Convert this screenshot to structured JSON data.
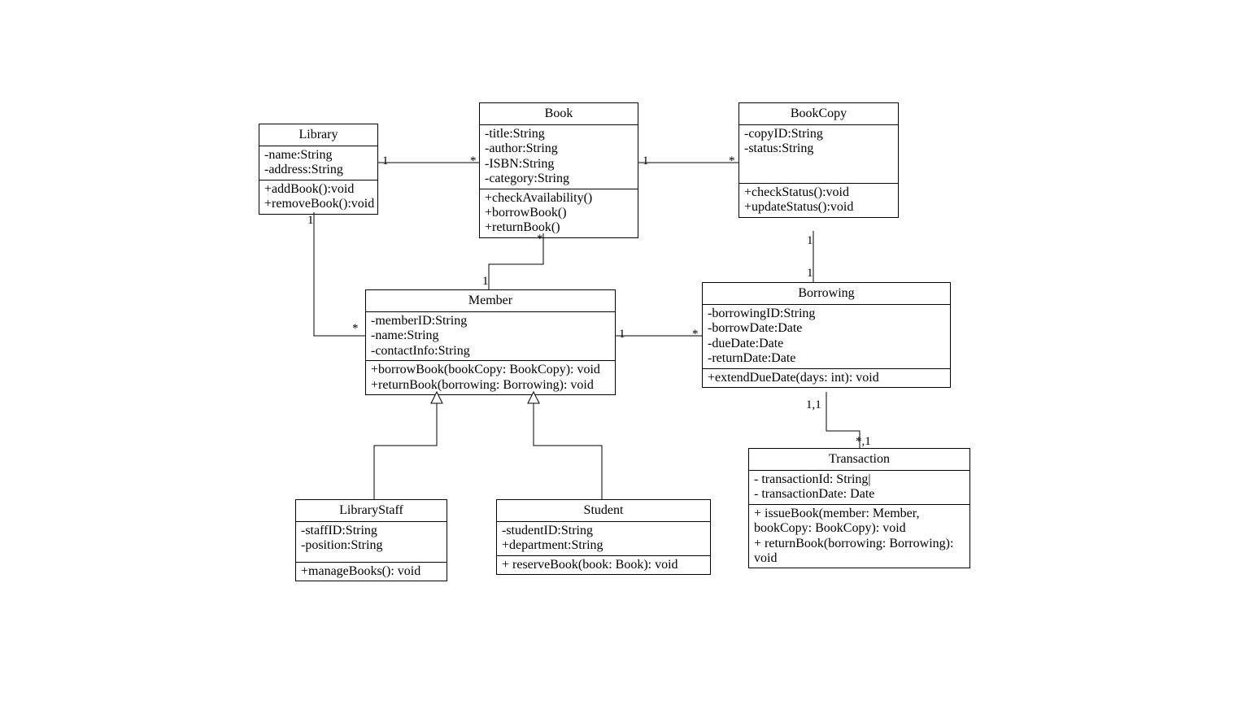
{
  "classes": {
    "library": {
      "name": "Library",
      "attrs": [
        "-name:String",
        "-address:String"
      ],
      "ops": [
        "+addBook():void",
        "+removeBook():void"
      ]
    },
    "book": {
      "name": "Book",
      "attrs": [
        "-title:String",
        "-author:String",
        "-ISBN:String",
        "-category:String"
      ],
      "ops": [
        "+checkAvailability()",
        "+borrowBook()",
        "+returnBook()"
      ]
    },
    "bookcopy": {
      "name": "BookCopy",
      "attrs": [
        "-copyID:String",
        "-status:String"
      ],
      "ops": [
        "+checkStatus():void",
        "+updateStatus():void"
      ]
    },
    "member": {
      "name": "Member",
      "attrs": [
        "-memberID:String",
        "-name:String",
        "-contactInfo:String"
      ],
      "ops": [
        "+borrowBook(bookCopy: BookCopy): void",
        "+returnBook(borrowing: Borrowing): void"
      ]
    },
    "borrowing": {
      "name": "Borrowing",
      "attrs": [
        "-borrowingID:String",
        "-borrowDate:Date",
        "-dueDate:Date",
        "-returnDate:Date"
      ],
      "ops": [
        "+extendDueDate(days: int): void"
      ]
    },
    "librarystaff": {
      "name": "LibraryStaff",
      "attrs": [
        "-staffID:String",
        "-position:String"
      ],
      "ops": [
        "+manageBooks(): void"
      ]
    },
    "student": {
      "name": "Student",
      "attrs": [
        "-studentID:String",
        "+department:String"
      ],
      "ops": [
        "+ reserveBook(book: Book): void"
      ]
    },
    "transaction": {
      "name": "Transaction",
      "attrs": [
        "- transactionId: String|",
        "- transactionDate: Date"
      ],
      "ops": [
        "+ issueBook(member: Member, bookCopy: BookCopy): void",
        "+ returnBook(borrowing: Borrowing): void"
      ]
    }
  },
  "mults": {
    "lib_book_l": "1",
    "lib_book_r": "*",
    "book_copy_l": "1",
    "book_copy_r": "*",
    "lib_member_t": "1",
    "lib_member_b": "*",
    "book_member_t": "*",
    "book_member_b": "1",
    "member_borrow_l": "1",
    "member_borrow_r": "*",
    "copy_borrow_t": "1",
    "copy_borrow_b": "1",
    "borrow_trans_t": "1,1",
    "borrow_trans_b": "*,1"
  },
  "chart_data": {
    "type": "table",
    "title": "UML Class Diagram — Library System",
    "classes": [
      {
        "name": "Library",
        "attributes": [
          "-name:String",
          "-address:String"
        ],
        "operations": [
          "+addBook():void",
          "+removeBook():void"
        ]
      },
      {
        "name": "Book",
        "attributes": [
          "-title:String",
          "-author:String",
          "-ISBN:String",
          "-category:String"
        ],
        "operations": [
          "+checkAvailability()",
          "+borrowBook()",
          "+returnBook()"
        ]
      },
      {
        "name": "BookCopy",
        "attributes": [
          "-copyID:String",
          "-status:String"
        ],
        "operations": [
          "+checkStatus():void",
          "+updateStatus():void"
        ]
      },
      {
        "name": "Member",
        "attributes": [
          "-memberID:String",
          "-name:String",
          "-contactInfo:String"
        ],
        "operations": [
          "+borrowBook(bookCopy: BookCopy): void",
          "+returnBook(borrowing: Borrowing): void"
        ]
      },
      {
        "name": "Borrowing",
        "attributes": [
          "-borrowingID:String",
          "-borrowDate:Date",
          "-dueDate:Date",
          "-returnDate:Date"
        ],
        "operations": [
          "+extendDueDate(days: int): void"
        ]
      },
      {
        "name": "LibraryStaff",
        "attributes": [
          "-staffID:String",
          "-position:String"
        ],
        "operations": [
          "+manageBooks(): void"
        ]
      },
      {
        "name": "Student",
        "attributes": [
          "-studentID:String",
          "+department:String"
        ],
        "operations": [
          "+ reserveBook(book: Book): void"
        ]
      },
      {
        "name": "Transaction",
        "attributes": [
          "- transactionId: String|",
          "- transactionDate: Date"
        ],
        "operations": [
          "+ issueBook(member: Member, bookCopy: BookCopy): void",
          "+ returnBook(borrowing: Borrowing): void"
        ]
      }
    ],
    "relationships": [
      {
        "from": "Library",
        "to": "Book",
        "type": "association",
        "from_mult": "1",
        "to_mult": "*"
      },
      {
        "from": "Book",
        "to": "BookCopy",
        "type": "association",
        "from_mult": "1",
        "to_mult": "*"
      },
      {
        "from": "Library",
        "to": "Member",
        "type": "association",
        "from_mult": "1",
        "to_mult": "*"
      },
      {
        "from": "Book",
        "to": "Member",
        "type": "association",
        "from_mult": "*",
        "to_mult": "1"
      },
      {
        "from": "Member",
        "to": "Borrowing",
        "type": "association",
        "from_mult": "1",
        "to_mult": "*"
      },
      {
        "from": "BookCopy",
        "to": "Borrowing",
        "type": "association",
        "from_mult": "1",
        "to_mult": "1"
      },
      {
        "from": "Borrowing",
        "to": "Transaction",
        "type": "association",
        "from_mult": "1,1",
        "to_mult": "*,1"
      },
      {
        "from": "LibraryStaff",
        "to": "Member",
        "type": "generalization"
      },
      {
        "from": "Student",
        "to": "Member",
        "type": "generalization"
      }
    ]
  }
}
